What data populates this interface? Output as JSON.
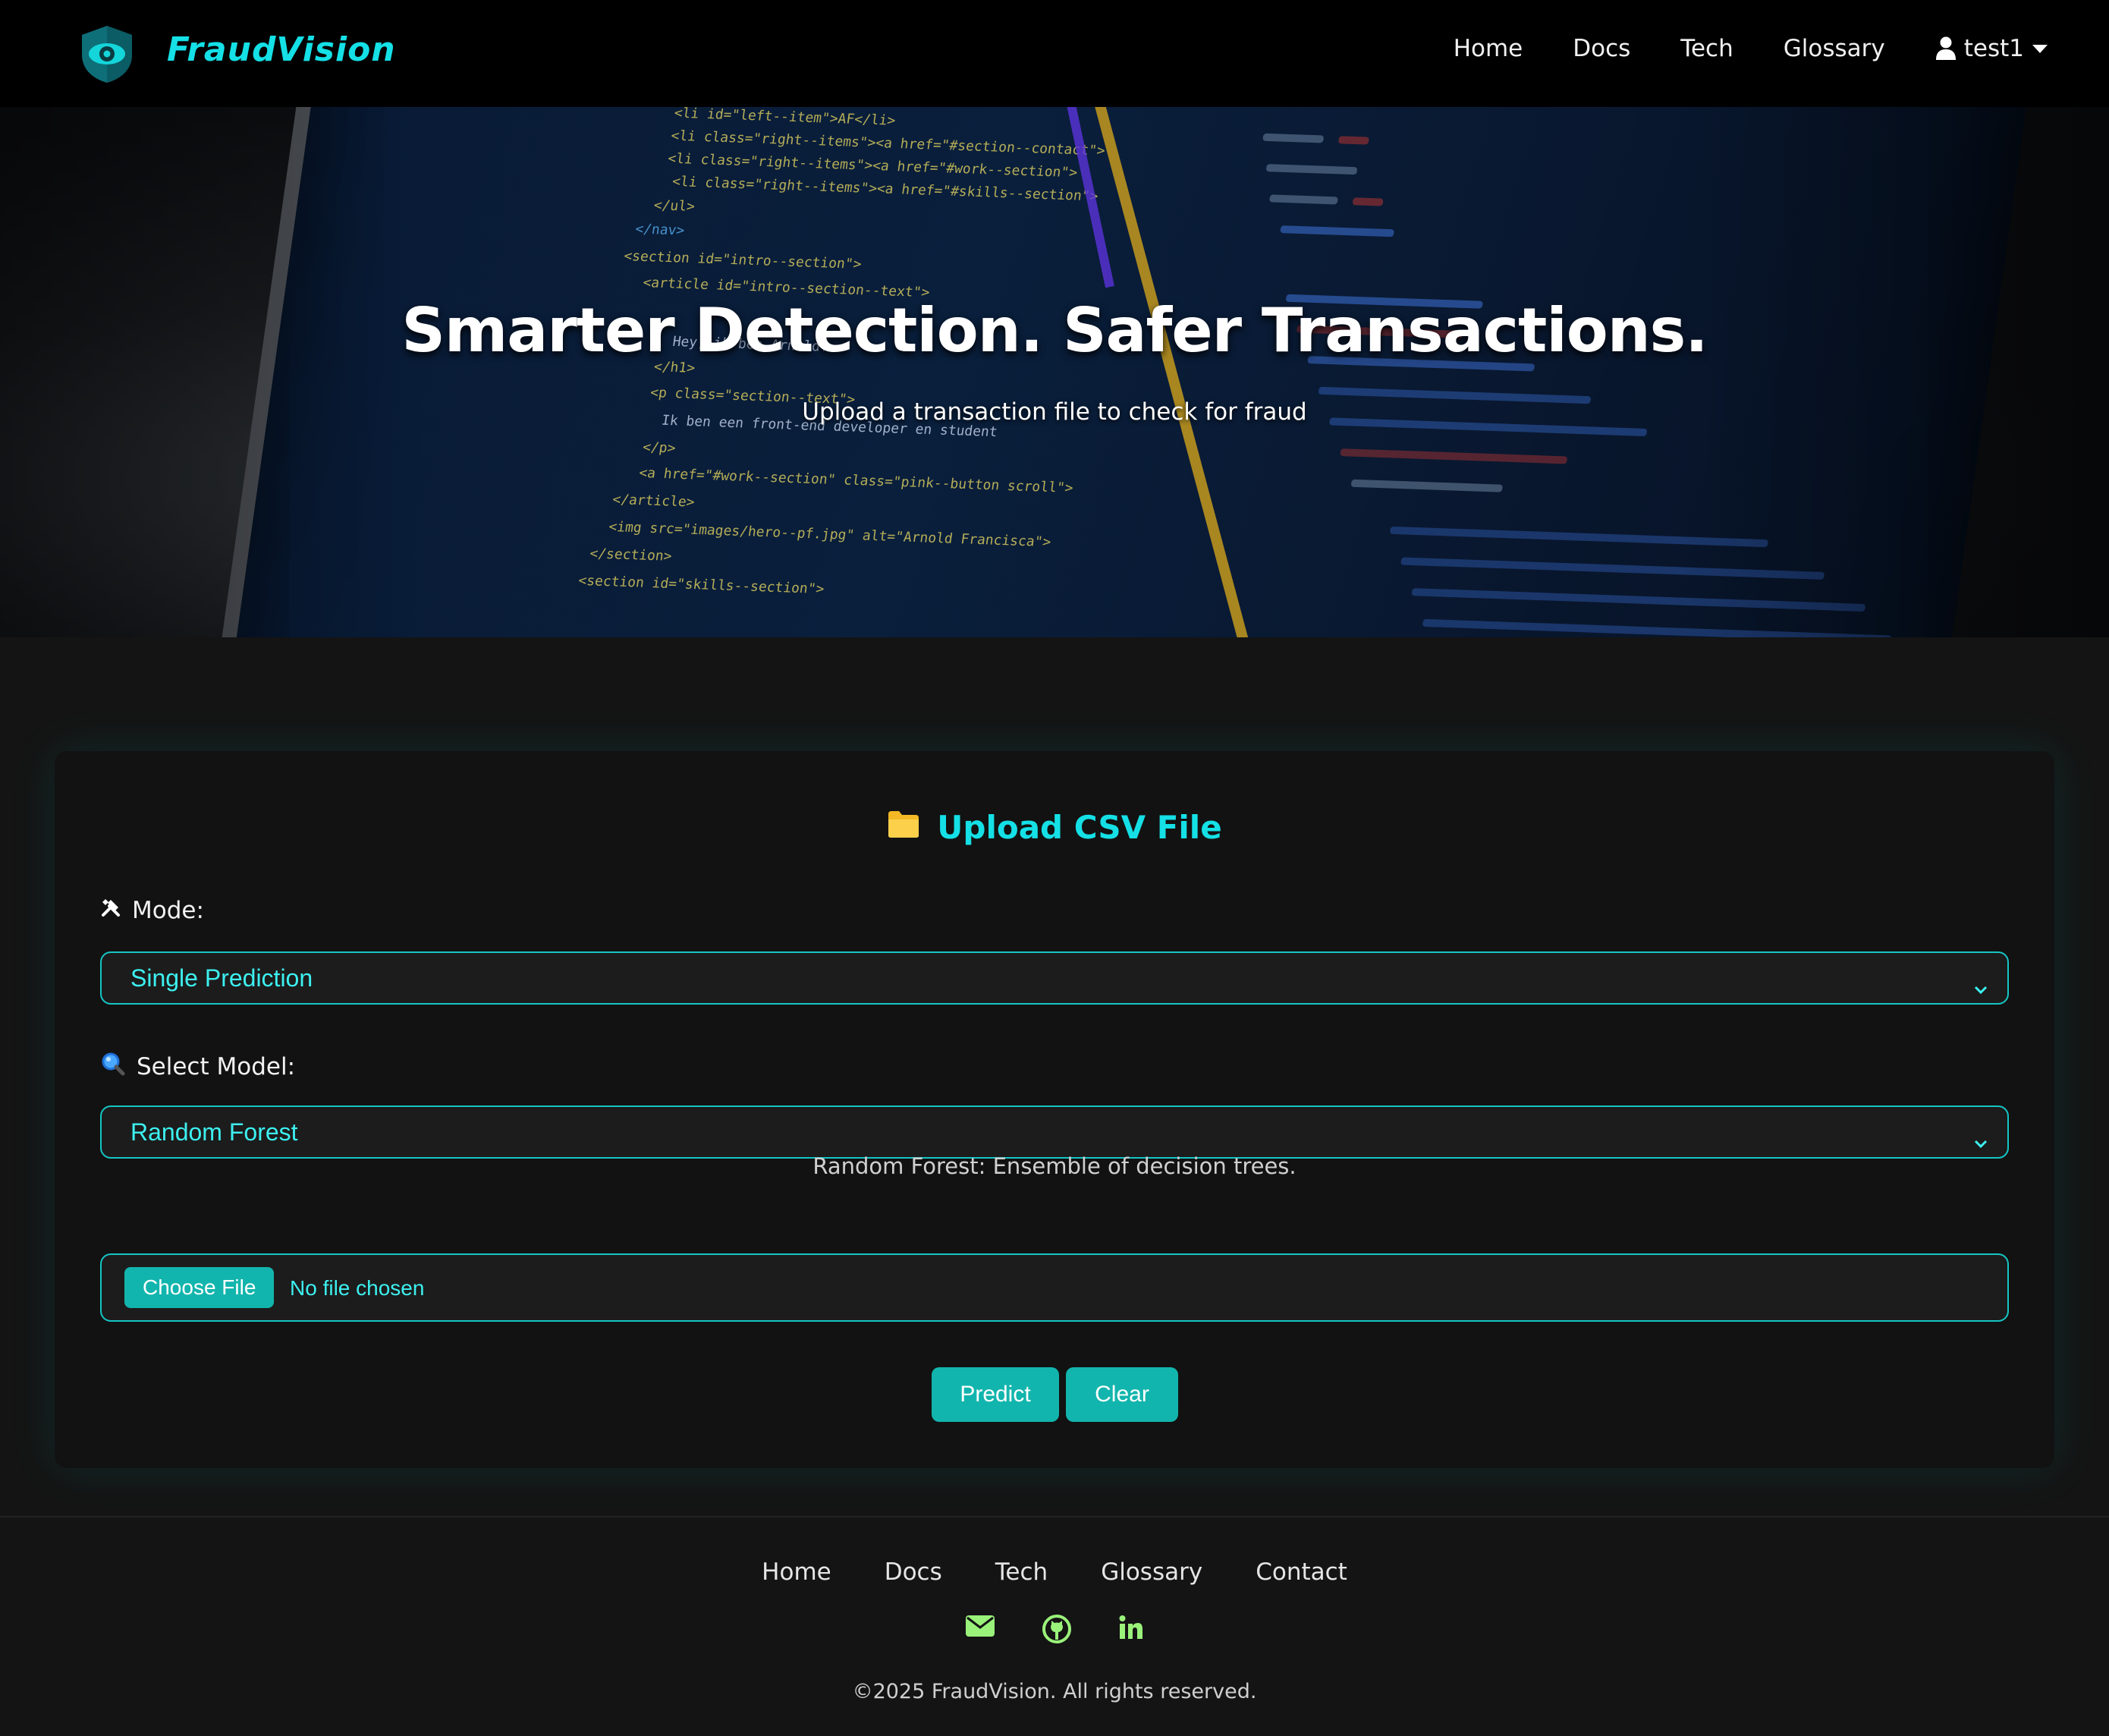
{
  "brand": {
    "name": "FraudVision",
    "logo_icon": "shield-eye-icon",
    "accent_color": "#14e0e6"
  },
  "navbar": {
    "links": [
      "Home",
      "Docs",
      "Tech",
      "Glossary"
    ],
    "user": {
      "name": "test1",
      "icon": "user-icon",
      "dropdown_icon": "caret-down-icon"
    }
  },
  "hero": {
    "title": "Smarter Detection. Safer Transactions.",
    "subtitle": "Upload a transaction file to check for fraud"
  },
  "upload_card": {
    "title": "Upload CSV File",
    "title_icon": "folder-icon",
    "mode": {
      "label": "Mode:",
      "icon": "tools-icon",
      "selected": "Single Prediction"
    },
    "model": {
      "label": "Select Model:",
      "icon": "magnifier-icon",
      "selected": "Random Forest",
      "description": "Random Forest: Ensemble of decision trees."
    },
    "file_input": {
      "button_label": "Choose File",
      "status": "No file chosen"
    },
    "buttons": {
      "predict": "Predict",
      "clear": "Clear"
    },
    "button_color": "#12b5ad"
  },
  "footer": {
    "links": [
      "Home",
      "Docs",
      "Tech",
      "Glossary",
      "Contact"
    ],
    "social_icons": [
      "envelope-icon",
      "github-icon",
      "linkedin-icon"
    ],
    "icon_color": "#9af27a",
    "copyright": "©2025 FraudVision. All rights reserved."
  }
}
